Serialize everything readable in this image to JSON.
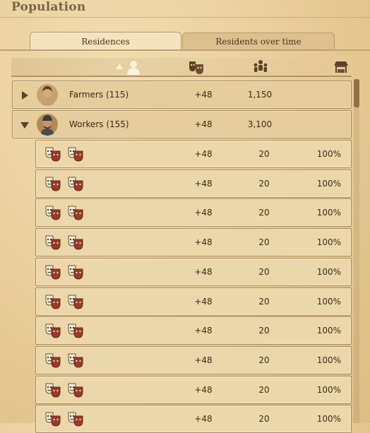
{
  "window": {
    "title": "Population"
  },
  "tabs": [
    {
      "label": "Residences",
      "active": true
    },
    {
      "label": "Residents over time",
      "active": false
    }
  ],
  "columns": {
    "resident_icon": "person-icon",
    "sort_icon": "sort-up-icon",
    "happiness_icon": "theater-masks-icon",
    "population_icon": "people-icon",
    "supply_icon": "market-stall-icon"
  },
  "groups": [
    {
      "name": "Farmers (115)",
      "happiness": "+48",
      "population": "1,150",
      "expanded": false
    },
    {
      "name": "Workers (155)",
      "happiness": "+48",
      "population": "3,100",
      "expanded": true
    }
  ],
  "residences": [
    {
      "happiness": "+48",
      "population": "20",
      "supply": "100%"
    },
    {
      "happiness": "+48",
      "population": "20",
      "supply": "100%"
    },
    {
      "happiness": "+48",
      "population": "20",
      "supply": "100%"
    },
    {
      "happiness": "+48",
      "population": "20",
      "supply": "100%"
    },
    {
      "happiness": "+48",
      "population": "20",
      "supply": "100%"
    },
    {
      "happiness": "+48",
      "population": "20",
      "supply": "100%"
    },
    {
      "happiness": "+48",
      "population": "20",
      "supply": "100%"
    },
    {
      "happiness": "+48",
      "population": "20",
      "supply": "100%"
    },
    {
      "happiness": "+48",
      "population": "20",
      "supply": "100%"
    },
    {
      "happiness": "+48",
      "population": "20",
      "supply": "100%"
    }
  ],
  "colors": {
    "background": "#e9cf9c",
    "row": "#ecd7ab",
    "border": "#a88a5e",
    "text": "#3d2a16",
    "title": "#7a6448"
  }
}
